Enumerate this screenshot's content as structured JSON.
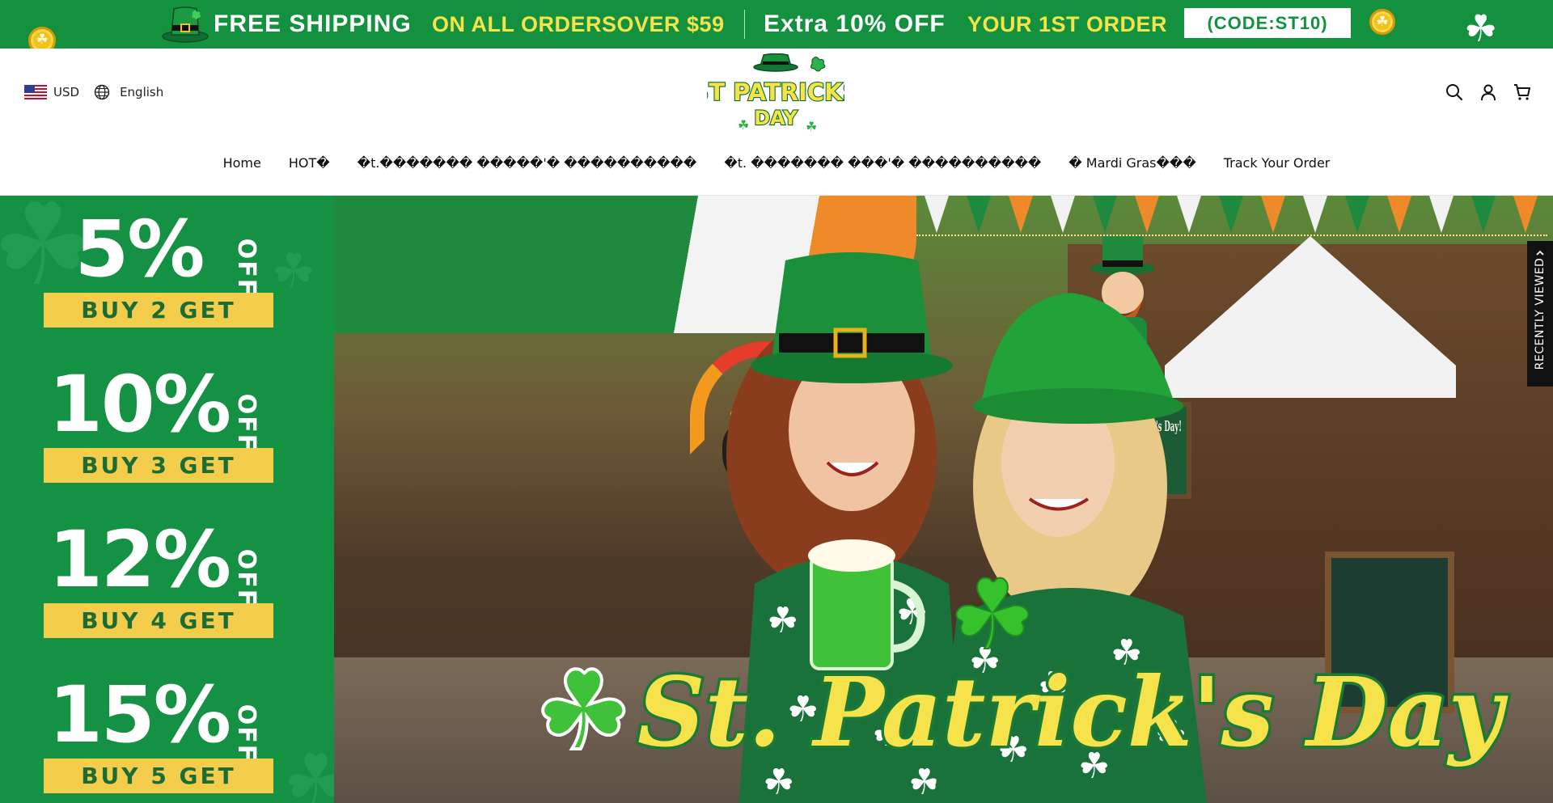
{
  "announcement": {
    "free_shipping": "FREE SHIPPING",
    "on_all_orders": "ON ALL ORDERSOVER $59",
    "extra_off": "Extra 10% OFF",
    "first_order": "YOUR 1ST ORDER",
    "code": "(CODE:ST10)",
    "background": "#14913f",
    "accent": "#f4e34a"
  },
  "header": {
    "currency": "USD",
    "language": "English",
    "logo_text": [
      "ST PATRICKS",
      "DAY"
    ],
    "icons": [
      "search-icon",
      "account-icon",
      "cart-icon"
    ]
  },
  "nav": {
    "items": [
      "Home",
      "HOT�",
      "�t.������� �����'� ����������",
      "�t. ������� ���'� ����������",
      "� Mardi Gras���",
      "Track Your Order"
    ]
  },
  "promo": {
    "off_label": "OFF",
    "tiers": [
      {
        "percent": "5%",
        "get": "BUY 2 GET"
      },
      {
        "percent": "10%",
        "get": "BUY 3 GET"
      },
      {
        "percent": "12%",
        "get": "BUY 4 GET"
      },
      {
        "percent": "15%",
        "get": "BUY 5 GET"
      }
    ],
    "background": "#159144",
    "bar_color": "#f5cd4d"
  },
  "hero": {
    "title": "St. Patrick's Day",
    "sign_text": "Happy St. Patrick's Day!"
  },
  "recently_viewed": {
    "label": "RECENTLY VIEWED"
  }
}
